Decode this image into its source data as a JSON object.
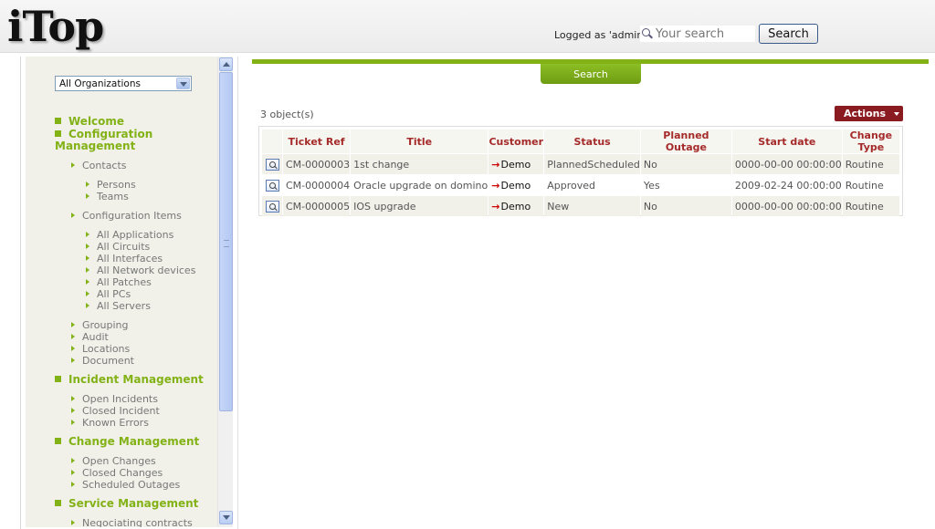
{
  "header": {
    "logo": "iTop",
    "logged_as": "Logged as 'admin'",
    "search_placeholder": "Your search",
    "search_button": "Search"
  },
  "sidebar": {
    "org_select": "All Organizations",
    "menu": [
      {
        "type": "head",
        "label": "Welcome"
      },
      {
        "type": "head",
        "label": "Configuration Management"
      },
      {
        "type": "item",
        "level": 1,
        "label": "Contacts"
      },
      {
        "type": "item",
        "level": 2,
        "label": "Persons"
      },
      {
        "type": "item",
        "level": 2,
        "label": "Teams"
      },
      {
        "type": "item",
        "level": 1,
        "label": "Configuration Items"
      },
      {
        "type": "item",
        "level": 2,
        "label": "All Applications"
      },
      {
        "type": "item",
        "level": 2,
        "label": "All Circuits"
      },
      {
        "type": "item",
        "level": 2,
        "label": "All Interfaces"
      },
      {
        "type": "item",
        "level": 2,
        "label": "All Network devices"
      },
      {
        "type": "item",
        "level": 2,
        "label": "All Patches"
      },
      {
        "type": "item",
        "level": 2,
        "label": "All PCs"
      },
      {
        "type": "item",
        "level": 2,
        "label": "All Servers"
      },
      {
        "type": "item",
        "level": 1,
        "label": "Grouping"
      },
      {
        "type": "item",
        "level": 1,
        "label": "Audit"
      },
      {
        "type": "item",
        "level": 1,
        "label": "Locations"
      },
      {
        "type": "item",
        "level": 1,
        "label": "Document"
      },
      {
        "type": "head",
        "label": "Incident Management"
      },
      {
        "type": "item",
        "level": 1,
        "label": "Open Incidents"
      },
      {
        "type": "item",
        "level": 1,
        "label": "Closed Incident"
      },
      {
        "type": "item",
        "level": 1,
        "label": "Known Errors"
      },
      {
        "type": "head",
        "label": "Change Management"
      },
      {
        "type": "item",
        "level": 1,
        "label": "Open Changes"
      },
      {
        "type": "item",
        "level": 1,
        "label": "Closed Changes"
      },
      {
        "type": "item",
        "level": 1,
        "label": "Scheduled Outages"
      },
      {
        "type": "head",
        "label": "Service Management"
      },
      {
        "type": "item",
        "level": 1,
        "label": "Negociating contracts"
      }
    ]
  },
  "main": {
    "search_tab": "Search",
    "object_count": "3 object(s)",
    "actions_label": "Actions",
    "columns": [
      "Ticket Ref",
      "Title",
      "Customer",
      "Status",
      "Planned Outage",
      "Start date",
      "Change Type"
    ],
    "rows": [
      {
        "ref": "CM-0000003",
        "title": "1st change",
        "customer": "Demo",
        "status": "PlannedScheduled",
        "outage": "No",
        "start": "0000-00-00 00:00:00",
        "type": "Routine"
      },
      {
        "ref": "CM-0000004",
        "title": "Oracle upgrade on domino",
        "customer": "Demo",
        "status": "Approved",
        "outage": "Yes",
        "start": "2009-02-24 00:00:00",
        "type": "Routine"
      },
      {
        "ref": "CM-0000005",
        "title": "IOS upgrade",
        "customer": "Demo",
        "status": "New",
        "outage": "No",
        "start": "0000-00-00 00:00:00",
        "type": "Routine"
      }
    ]
  },
  "colors": {
    "accent_green": "#83b217",
    "header_red": "#a52a2a",
    "actions_bg": "#8a1b20"
  },
  "icons": {
    "search": "search-icon",
    "row_details": "magnifier-doc-icon",
    "customer_link": "arrow-right-icon"
  }
}
